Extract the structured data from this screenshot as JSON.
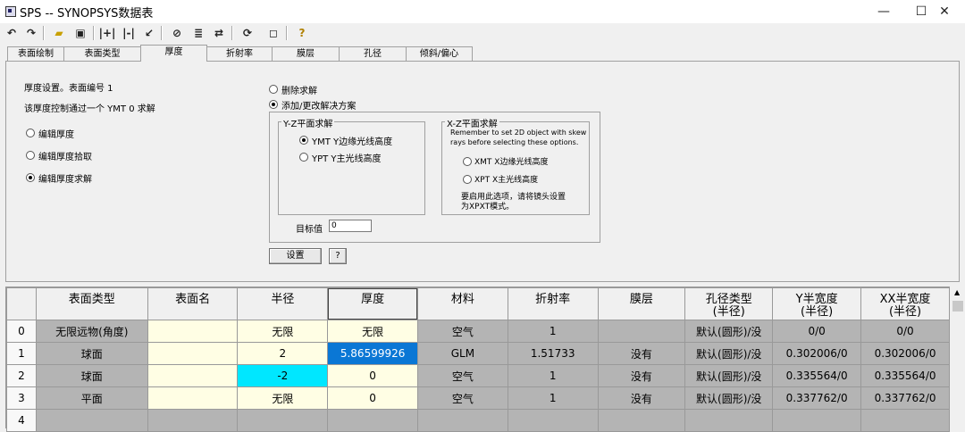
{
  "window": {
    "title": "SPS -- SYNOPSYS数据表",
    "controls": {
      "minimize": "—",
      "maximize": "☐",
      "close": "✕"
    }
  },
  "toolbar": {
    "icons": [
      "undo-icon",
      "redo-icon",
      "open-folder-icon",
      "save-icon",
      "insert-surface-icon",
      "delete-surface-icon",
      "pointer-icon",
      "eraser-icon",
      "list-icon",
      "swap-icon",
      "refresh-icon",
      "window-icon",
      "help-icon"
    ]
  },
  "tabs": [
    "表面绘制",
    "表面类型",
    "厚度",
    "折射率",
    "膜层",
    "孔径",
    "倾斜/偏心"
  ],
  "active_tab": 2,
  "panel": {
    "info_line1": "厚度设置。表面编号 1",
    "info_line2": "该厚度控制通过一个 YMT 0 求解",
    "modes": [
      {
        "label": "编辑厚度",
        "selected": false
      },
      {
        "label": "编辑厚度拾取",
        "selected": false
      },
      {
        "label": "编辑厚度求解",
        "selected": true
      }
    ],
    "solve_actions": [
      {
        "label": "删除求解",
        "selected": false
      },
      {
        "label": "添加/更改解决方案",
        "selected": true
      }
    ],
    "yz_group": {
      "title": "Y-Z平面求解",
      "options": [
        {
          "label": "YMT Y边缘光线高度",
          "selected": true
        },
        {
          "label": "YPT Y主光线高度",
          "selected": false
        }
      ]
    },
    "xz_group": {
      "title": "X-Z平面求解",
      "note_line1": "Remember to set 2D object with skew",
      "note_line2": "rays before selecting these options.",
      "options": [
        {
          "label": "XMT X边缘光线高度",
          "selected": false
        },
        {
          "label": "XPT X主光线高度",
          "selected": false
        }
      ],
      "hint_line1": "要启用此选项，请将镜头设置",
      "hint_line2": "为XPXT模式。"
    },
    "target_label": "目标值",
    "target_value": "0",
    "set_button": "设置",
    "help_button": "?"
  },
  "grid": {
    "columns": [
      "表面类型",
      "表面名",
      "半径",
      "厚度",
      "材料",
      "折射率",
      "膜层",
      "孔径类型",
      "Y半宽度",
      "XX半宽度"
    ],
    "columns_sub": [
      "",
      "",
      "",
      "",
      "",
      "",
      "",
      "(半径)",
      "(半径)",
      "(半径)"
    ],
    "rows": [
      {
        "index": "0",
        "cells": [
          "无限远物(角度)",
          "",
          "无限",
          "无限",
          "空气",
          "1",
          "",
          "默认(圆形)/没",
          "0/0",
          "0/0"
        ]
      },
      {
        "index": "1",
        "cells": [
          "球面",
          "",
          "2",
          "5.86599926",
          "GLM",
          "1.51733",
          "没有",
          "默认(圆形)/没",
          "0.302006/0",
          "0.302006/0"
        ]
      },
      {
        "index": "2",
        "cells": [
          "球面",
          "",
          "-2",
          "0",
          "空气",
          "1",
          "没有",
          "默认(圆形)/没",
          "0.335564/0",
          "0.335564/0"
        ]
      },
      {
        "index": "3",
        "cells": [
          "平面",
          "",
          "无限",
          "0",
          "空气",
          "1",
          "没有",
          "默认(圆形)/没",
          "0.337762/0",
          "0.337762/0"
        ]
      },
      {
        "index": "4",
        "cells": [
          "",
          "",
          "",
          "",
          "",
          "",
          "",
          "",
          "",
          ""
        ]
      }
    ]
  }
}
